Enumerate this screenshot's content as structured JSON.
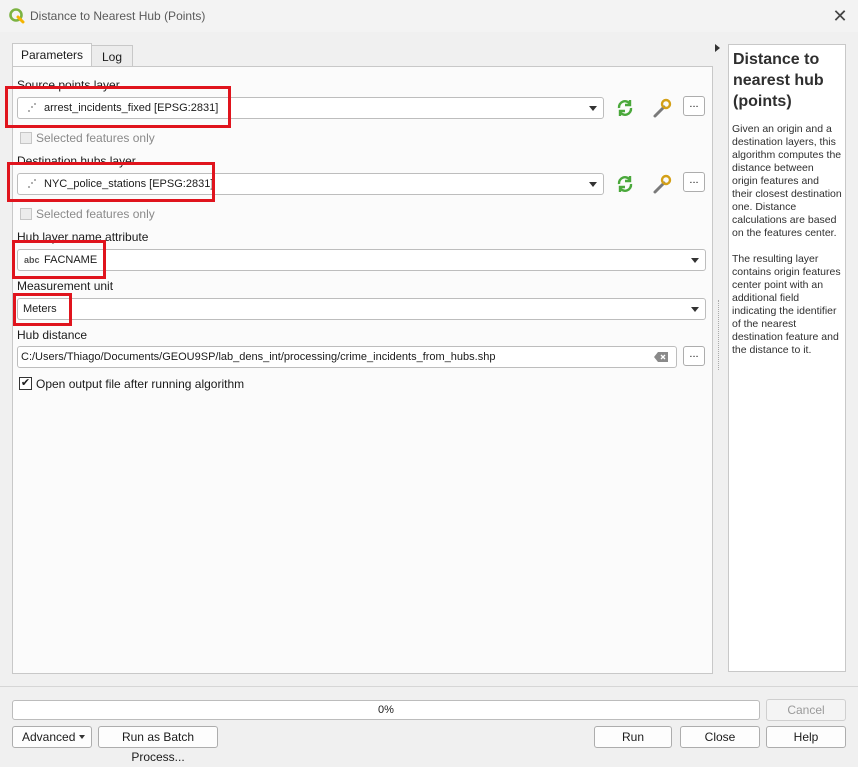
{
  "window": {
    "title": "Distance to Nearest Hub (Points)",
    "close_glyph": "✕"
  },
  "tabs": [
    {
      "label": "Parameters"
    },
    {
      "label": "Log"
    }
  ],
  "params": {
    "source_label": "Source points layer",
    "source_value": "arrest_incidents_fixed [EPSG:2831]",
    "source_selected_only": "Selected features only",
    "dest_label": "Destination hubs layer",
    "dest_value": "NYC_police_stations [EPSG:2831]",
    "dest_selected_only": "Selected features only",
    "hub_attr_label": "Hub layer name attribute",
    "hub_attr_type": "abc",
    "hub_attr_value": "FACNAME",
    "unit_label": "Measurement unit",
    "unit_value": "Meters",
    "distance_label": "Hub distance",
    "distance_value": "C:/Users/Thiago/Documents/GEOU9SP/lab_dens_int/processing/crime_incidents_from_hubs.shp",
    "open_output_label": "Open output file after running algorithm",
    "open_output_checked": true,
    "dots_label": "..."
  },
  "help": {
    "title": "Distance to nearest hub (points)",
    "paragraph1": "Given an origin and a destination layers, this algorithm computes the distance between origin features and their closest destination one. Distance calculations are based on the features center.",
    "paragraph2": "The resulting layer contains origin features center point with an additional field indicating the identifier of the nearest destination feature and the distance to it."
  },
  "footer": {
    "progress_text": "0%",
    "progress_value": 0,
    "cancel_label": "Cancel",
    "advanced_label": "Advanced",
    "batch_label": "Run as Batch Process...",
    "run_label": "Run",
    "close_label": "Close",
    "help_label": "Help"
  },
  "colors": {
    "highlight_red": "#e0141d",
    "refresh_green": "#4aa83b"
  }
}
